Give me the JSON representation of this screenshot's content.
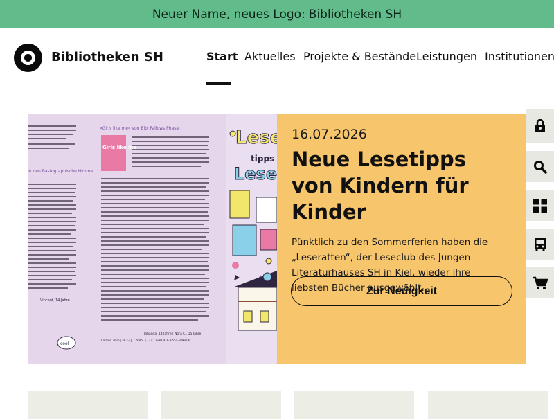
{
  "banner": {
    "text": "Neuer Name, neues Logo:",
    "link": "Bibliotheken SH"
  },
  "brand": {
    "name": "Bibliotheken SH"
  },
  "nav": [
    "Start",
    "Aktuelles",
    "Projekte & Bestände",
    "Leistungen",
    "Institutionen"
  ],
  "hero": {
    "date": "16.07.2026",
    "title": "Neue Lesetipps von Kindern für Kinder",
    "text": "Pünktlich zu den Sommerferien haben die „Leseratten“, der Leseclub des Jungen Literaturhauses SH in Kiel, wieder ihre liebsten Bücher ausgewählt.",
    "button": "Zur Neuigkeit",
    "image": {
      "cover_title": "Girls like me",
      "header_left": "In den Bastographische Himme",
      "header_right": "»Girls like me« von Bibi Fallows Phasai",
      "signature": "Vincent, 14 Jahre",
      "credit": "Johanna, 14 Jahre | Nora C., 15 Jahre",
      "isbn": "Carlsen 2026 | ab 14 J. | 208 S. | 13 € | ISBN 978-3-551-58982-6",
      "bubble": "cool",
      "banner_lines": [
        "Lese",
        "tipps der",
        "Leseratten"
      ],
      "accent_colors": [
        "#e5d6ec",
        "#f2e76b",
        "#e87aa5",
        "#8ad0e8",
        "#2f2540"
      ]
    }
  },
  "sidebar": [
    "lock-icon",
    "search-icon",
    "grid-icon",
    "bus-icon",
    "cart-icon"
  ]
}
